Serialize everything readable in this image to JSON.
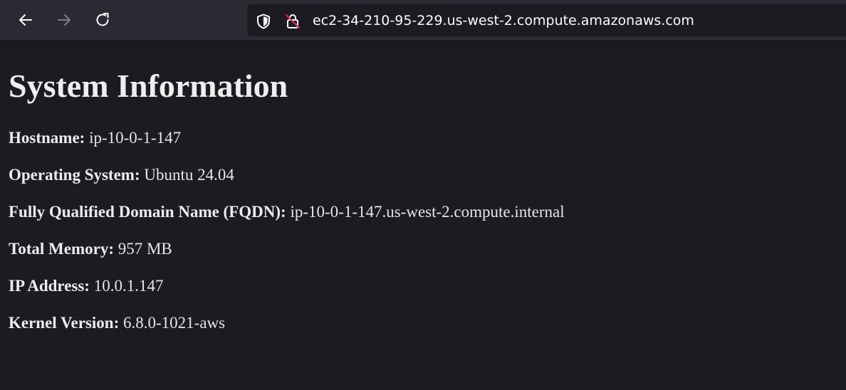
{
  "browser": {
    "url": "ec2-34-210-95-229.us-west-2.compute.amazonaws.com",
    "icons": {
      "back": "arrow-left-icon",
      "forward": "arrow-right-icon",
      "reload": "reload-icon",
      "tracking": "shield-icon",
      "security": "insecure-lock-icon"
    },
    "forward_disabled": true,
    "colors": {
      "toolbar": "#2b2a33",
      "urlbar": "#1c1b22",
      "page_bg": "#1c1b22",
      "insecure_slash": "#e22850"
    }
  },
  "page": {
    "title": "System Information",
    "items": [
      {
        "label": "Hostname:",
        "value": "ip-10-0-1-147"
      },
      {
        "label": "Operating System:",
        "value": "Ubuntu 24.04"
      },
      {
        "label": "Fully Qualified Domain Name (FQDN):",
        "value": "ip-10-0-1-147.us-west-2.compute.internal"
      },
      {
        "label": "Total Memory:",
        "value": "957 MB"
      },
      {
        "label": "IP Address:",
        "value": "10.0.1.147"
      },
      {
        "label": "Kernel Version:",
        "value": "6.8.0-1021-aws"
      }
    ]
  }
}
